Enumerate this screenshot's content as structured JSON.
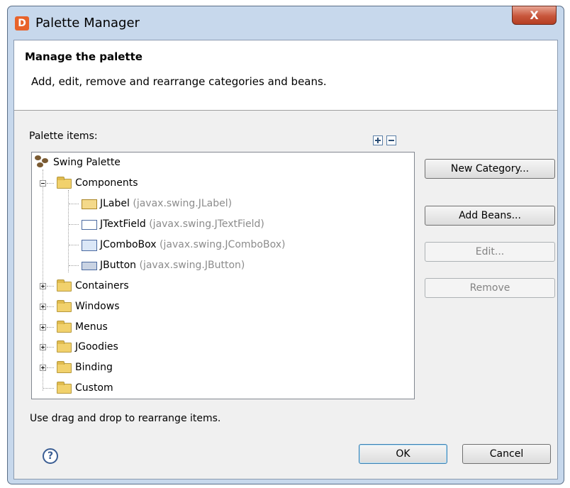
{
  "window": {
    "title": "Palette Manager",
    "app_icon": "app-icon",
    "close_label": "X"
  },
  "header": {
    "title": "Manage the palette",
    "description": "Add, edit, remove and rearrange categories and beans."
  },
  "tree_section": {
    "label": "Palette items:",
    "expand_all_icon": "expand-all-icon",
    "collapse_all_icon": "collapse-all-icon"
  },
  "tree": {
    "root": "Swing Palette",
    "components": "Components",
    "beans": [
      {
        "name": "JLabel",
        "pkg": "(javax.swing.JLabel)"
      },
      {
        "name": "JTextField",
        "pkg": "(javax.swing.JTextField)"
      },
      {
        "name": "JComboBox",
        "pkg": "(javax.swing.JComboBox)"
      },
      {
        "name": "JButton",
        "pkg": "(javax.swing.JButton)"
      }
    ],
    "categories": [
      "Containers",
      "Windows",
      "Menus",
      "JGoodies",
      "Binding",
      "Custom"
    ]
  },
  "buttons": {
    "new_category": "New Category...",
    "add_beans": "Add Beans...",
    "edit": "Edit...",
    "remove": "Remove",
    "ok": "OK",
    "cancel": "Cancel"
  },
  "hint": "Use drag and drop to rearrange items.",
  "help_icon": {
    "glyph": "?"
  }
}
